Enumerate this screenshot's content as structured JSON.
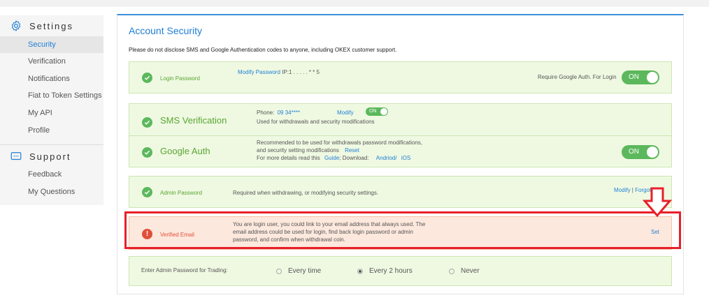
{
  "sidebar": {
    "settings_header": "Settings",
    "settings_items": [
      {
        "label": "Security",
        "active": true
      },
      {
        "label": "Verification"
      },
      {
        "label": "Notifications"
      },
      {
        "label": "Fiat to Token Settings"
      },
      {
        "label": "My API"
      },
      {
        "label": "Profile"
      }
    ],
    "support_header": "Support",
    "support_items": [
      {
        "label": "Feedback"
      },
      {
        "label": "My Questions"
      }
    ]
  },
  "main": {
    "title": "Account Security",
    "notice": "Please do not disclose SMS and Google Authentication codes to anyone, including OKEX customer support.",
    "login_password": {
      "label": "Login Password",
      "modify_link": "Modify Password",
      "ip_text": "IP:1 . . . . . * * 5",
      "require_text": "Require Google Auth. For Login",
      "toggle": "ON"
    },
    "sms": {
      "label": "SMS Verification",
      "phone_prefix": "Phone:",
      "phone_value": "09        34****",
      "modify_link": "Modify",
      "toggle": "ON",
      "desc": "Used for withdrawals and security modifications"
    },
    "google": {
      "label": "Google Auth",
      "line1": "Recommended to be used for withdrawals password modifications,",
      "line2": "and security setting modifications",
      "reset_link": "Reset",
      "line3_prefix": "For more details read this",
      "guide_link": "Guide",
      "download_text": "; Download:",
      "android_link": "Andriod/",
      "ios_link": "iOS",
      "toggle": "ON"
    },
    "admin_password": {
      "label": "Admin Password",
      "desc": "Required when withdrawing, or modifying security settings.",
      "modify_link": "Modify",
      "separator": "|",
      "forgot_link": "Forgot"
    },
    "verified_email": {
      "label": "Verified Email",
      "line1": "You are login user, you could link to your email address that always used. The",
      "line2": "email address could be used for login, find back login password or admin",
      "line3": "password, and confirm when withdrawal coin.",
      "set_link": "Set"
    },
    "trading": {
      "label": "Enter Admin Password for Trading:",
      "options": [
        {
          "label": "Every time",
          "selected": false
        },
        {
          "label": "Every 2 hours",
          "selected": true
        },
        {
          "label": "Never",
          "selected": false
        }
      ]
    }
  },
  "colors": {
    "accent": "#1f7fd5",
    "success": "#5cb85c",
    "success_bg": "#eff9e2",
    "warning_bg": "#fde8dd",
    "danger": "#e04f3a",
    "highlight": "#e8202a"
  }
}
